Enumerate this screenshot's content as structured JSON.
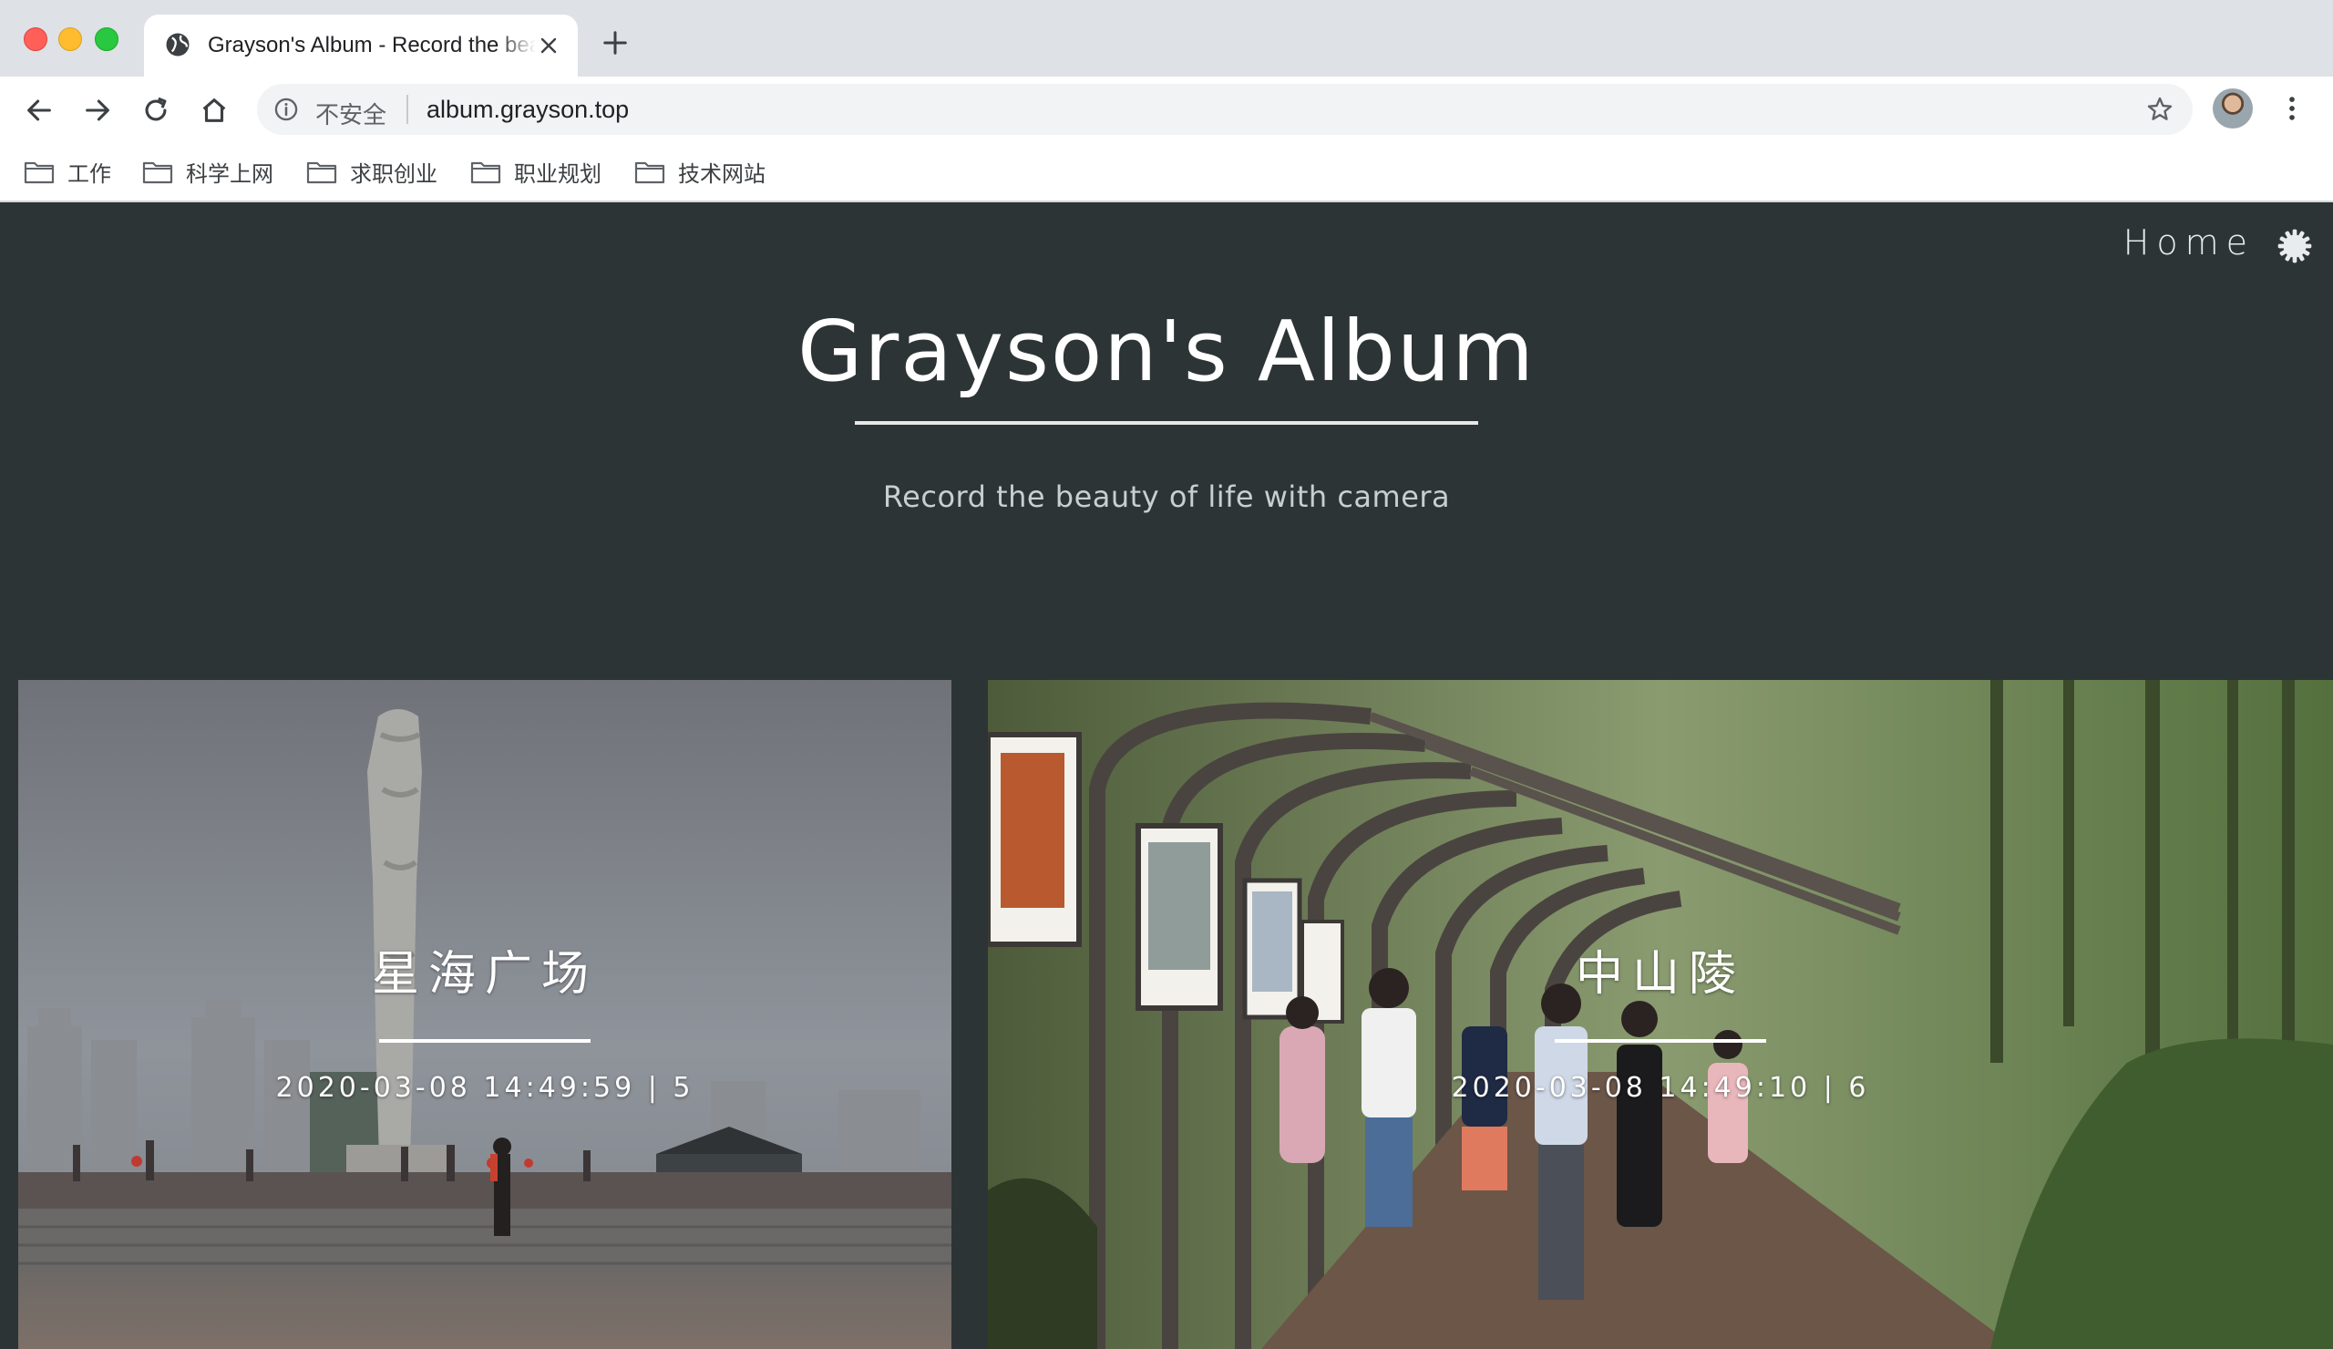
{
  "browser": {
    "tab_title": "Grayson's Album - Record the beauty of life with camera",
    "security_label": "不安全",
    "url": "album.grayson.top",
    "bookmarks": [
      "工作",
      "科学上网",
      "求职创业",
      "职业规划",
      "技术网站"
    ]
  },
  "header": {
    "nav_home": "Home",
    "title": "Grayson's Album",
    "subtitle": "Record the beauty of life with camera"
  },
  "albums": [
    {
      "title": "星海广场",
      "date": "2020-03-08 14:49:59",
      "count": "5",
      "meta": "2020-03-08 14:49:59 | 5"
    },
    {
      "title": "中山陵",
      "date": "2020-03-08 14:49:10",
      "count": "6",
      "meta": "2020-03-08 14:49:10 | 6"
    }
  ],
  "colors": {
    "page_bg": "#2d3436",
    "text": "#ffffff",
    "subtitle": "#c8ced1"
  }
}
